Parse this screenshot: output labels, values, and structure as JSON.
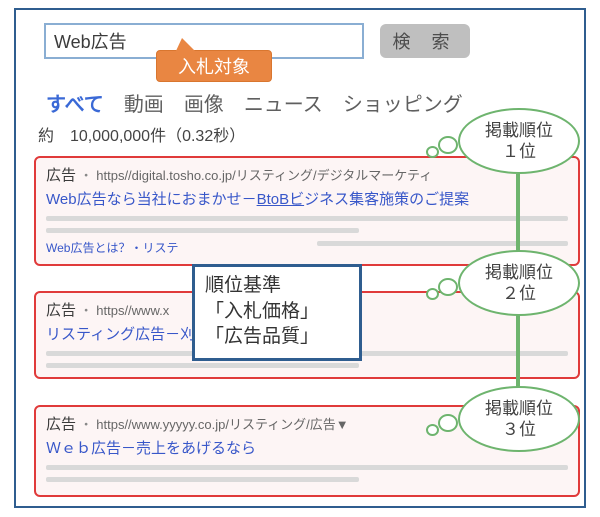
{
  "search": {
    "query": "Web広告",
    "button": "検 索"
  },
  "callout_bid_target": "入札対象",
  "tabs": {
    "all": "すべて",
    "video": "動画",
    "image": "画像",
    "news": "ニュース",
    "shopping": "ショッピング"
  },
  "results_info": "約　10,000,000件（0.32秒）",
  "ads": [
    {
      "tag": "広告",
      "url": "https//digital.tosho.co.jp/リスティング/デジタルマーケティ",
      "title_pre": "Web広告なら当社におまかせ－",
      "title_link": "BtoBビ",
      "title_post": "ジネス集客施策のご提案",
      "sublinks": [
        "Web広告とは？・リステ"
      ]
    },
    {
      "tag": "広告",
      "url": "https//www.x",
      "title": "リスティング広告－刈り取"
    },
    {
      "tag": "広告",
      "url": "https//www.yyyyy.co.jp/リスティング/広告▼",
      "title": "Ｗｅｂ広告－売上をあげるなら"
    }
  ],
  "criteria": {
    "heading": "順位基準",
    "line1": "「入札価格」",
    "line2": "「広告品質」"
  },
  "bubbles": {
    "rank1": "掲載順位\n１位",
    "rank2": "掲載順位\n２位",
    "rank3": "掲載順位\n３位"
  }
}
